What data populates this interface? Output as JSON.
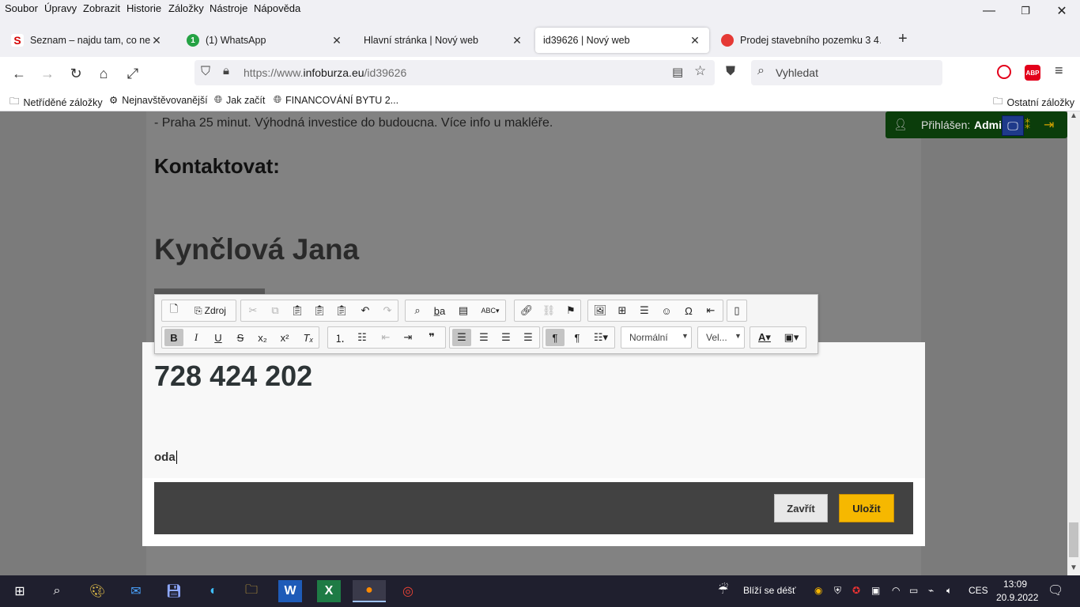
{
  "menu": [
    "Soubor",
    "Úpravy",
    "Zobrazit",
    "Historie",
    "Záložky",
    "Nástroje",
    "Nápověda"
  ],
  "window_controls": {
    "minimize": "—",
    "maximize": "❐",
    "close": "✕"
  },
  "tabs": [
    {
      "title": "Seznam – najdu tam, co neznám",
      "favicon": "S",
      "color": "#d50000"
    },
    {
      "title": "(1) WhatsApp",
      "favicon": "1",
      "color": "#25a244"
    },
    {
      "title": "Hlavní stránka | Nový web",
      "favicon": "",
      "color": ""
    },
    {
      "title": "id39626 | Nový web",
      "favicon": "",
      "color": ""
    },
    {
      "title": "Prodej stavebního pozemku 3 4…",
      "favicon": "",
      "color": "#e53935"
    }
  ],
  "new_tab": "+",
  "url": {
    "prefix": "https://www.",
    "domain": "infoburza.eu",
    "path": "/id39626"
  },
  "search_placeholder": "Vyhledat",
  "bookmarks": [
    "Netříděné záložky",
    "Nejnavštěvovanější",
    "Jak začít",
    "FINANCOVÁNÍ BYTU 2..."
  ],
  "other_bookmarks": "Ostatní záložky",
  "page": {
    "intro": "- Praha 25 minut. Výhodná investice do budoucna. Více info u makléře.",
    "contact_heading": "Kontaktovat:",
    "agent_name": "Kynčlová Jana",
    "phone": "728 424 202",
    "typed_text": "oda"
  },
  "login": {
    "label": "Přihlášen:",
    "user": "Admi"
  },
  "editor": {
    "source_label": "Zdroj",
    "format_select": "Normální",
    "size_select": "Vel..."
  },
  "buttons": {
    "close": "Zavřít",
    "save": "Uložit"
  },
  "taskbar": {
    "weather": "Blíží se déšť",
    "lang": "CES",
    "time": "13:09",
    "date": "20.9.2022"
  }
}
